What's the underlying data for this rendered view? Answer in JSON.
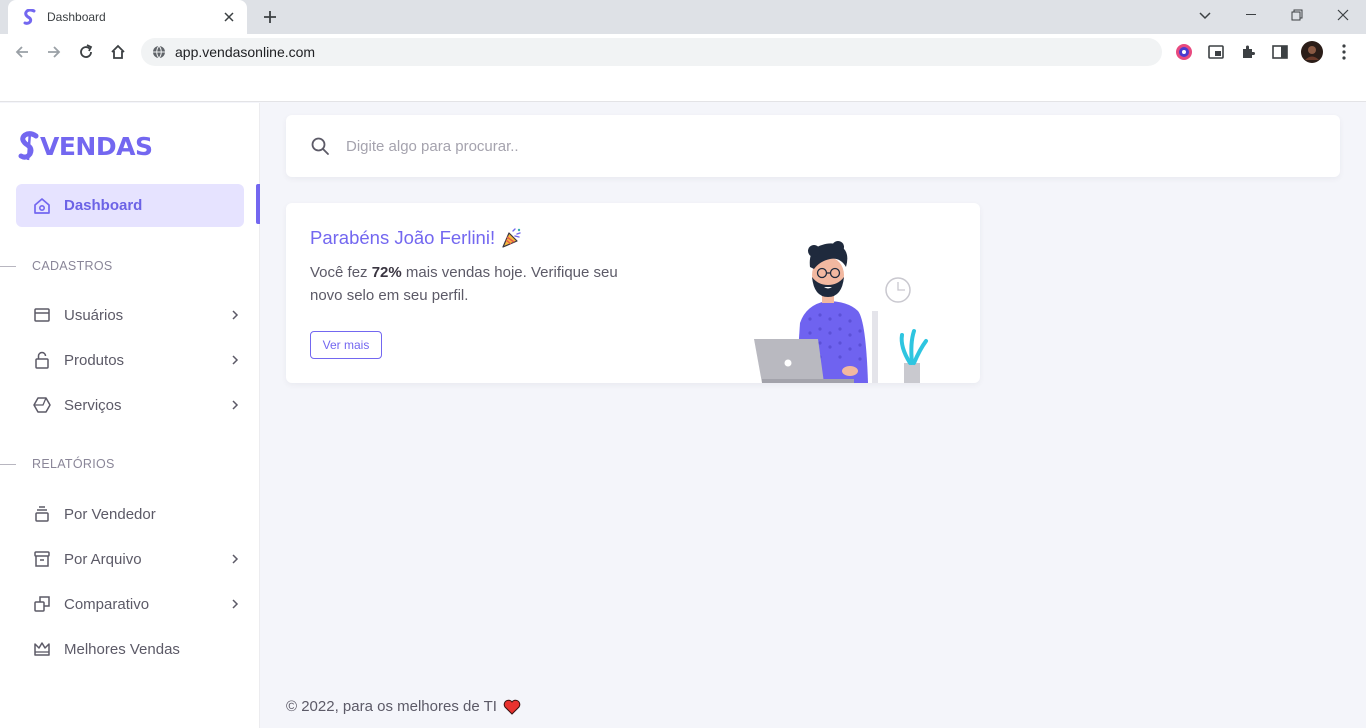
{
  "browser": {
    "tab_title": "Dashboard",
    "url": "app.vendasonline.com"
  },
  "sidebar": {
    "logo_text": "VENDAS",
    "active_item": {
      "label": "Dashboard",
      "icon": "home-icon"
    },
    "sections": [
      {
        "title": "CADASTROS",
        "items": [
          {
            "label": "Usuários",
            "icon": "browser-window-icon",
            "has_submenu": true
          },
          {
            "label": "Produtos",
            "icon": "lock-icon",
            "has_submenu": true
          },
          {
            "label": "Serviços",
            "icon": "hexagon-icon",
            "has_submenu": true
          }
        ]
      },
      {
        "title": "RELATÓRIOS",
        "items": [
          {
            "label": "Por Vendedor",
            "icon": "stack-icon",
            "has_submenu": false
          },
          {
            "label": "Por Arquivo",
            "icon": "archive-icon",
            "has_submenu": true
          },
          {
            "label": "Comparativo",
            "icon": "copy-icon",
            "has_submenu": true
          },
          {
            "label": "Melhores Vendas",
            "icon": "crown-icon",
            "has_submenu": false
          }
        ]
      }
    ]
  },
  "search": {
    "placeholder": "Digite algo para procurar.."
  },
  "welcome_card": {
    "title": "Parabéns João Ferlini!",
    "text_before": "Você fez ",
    "highlight": "72%",
    "text_after": " mais vendas hoje. Verifique seu novo selo em seu perfil.",
    "button_label": "Ver mais"
  },
  "footer": {
    "text": "© 2022, para os melhores de TI"
  },
  "colors": {
    "primary": "#7367f0",
    "primary_light": "#e6e3ff",
    "background": "#f4f5fa"
  }
}
